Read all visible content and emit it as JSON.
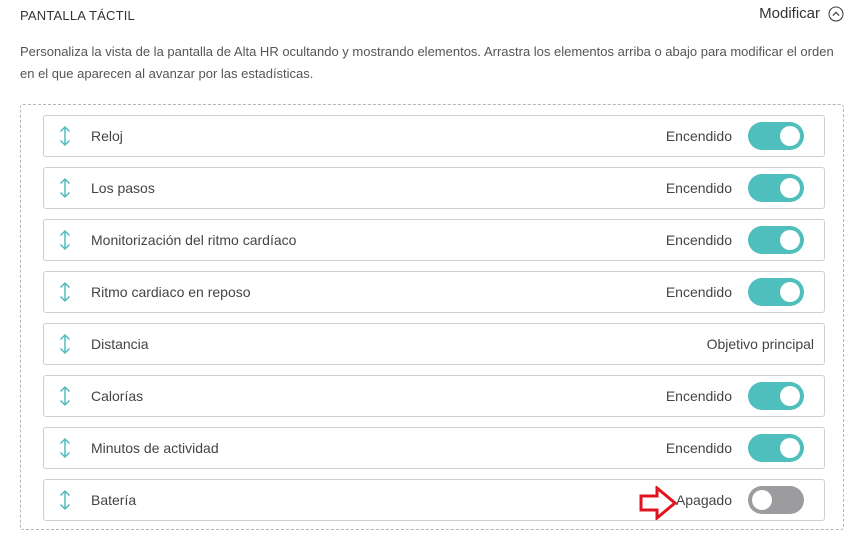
{
  "header": {
    "title": "PANTALLA TÁCTIL",
    "modify_label": "Modificar"
  },
  "description": "Personaliza la vista de la pantalla de Alta HR ocultando y mostrando elementos. Arrastra los elementos arriba o abajo para modificar el orden en el que aparecen al avanzar por las estadísticas.",
  "colors": {
    "toggle_on": "#4fbfbd",
    "toggle_off": "#9c9c9e",
    "drag_icon": "#4fbfbd",
    "annotation_arrow": "#e0141e"
  },
  "items": [
    {
      "label": "Reloj",
      "status": "Encendido",
      "toggle": "on"
    },
    {
      "label": "Los pasos",
      "status": "Encendido",
      "toggle": "on"
    },
    {
      "label": "Monitorización del ritmo cardíaco",
      "status": "Encendido",
      "toggle": "on"
    },
    {
      "label": "Ritmo cardiaco en reposo",
      "status": "Encendido",
      "toggle": "on"
    },
    {
      "label": "Distancia",
      "status": "Objetivo principal",
      "toggle": "none"
    },
    {
      "label": "Calorías",
      "status": "Encendido",
      "toggle": "on"
    },
    {
      "label": "Minutos de actividad",
      "status": "Encendido",
      "toggle": "on"
    },
    {
      "label": "Batería",
      "status": "Apagado",
      "toggle": "off"
    }
  ]
}
